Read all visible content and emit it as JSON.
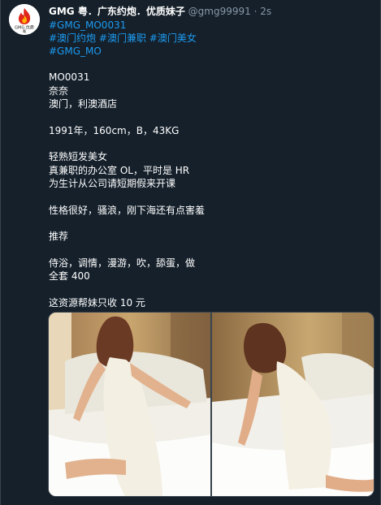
{
  "author": {
    "avatar_text": "GMG.优质",
    "avatar_sub": "粤",
    "display_name": "GMG 粤．广东约炮．优质妹子",
    "handle": "@gmg99991",
    "separator": "·",
    "time": "2s"
  },
  "hashtags": {
    "line1": [
      "#GMG_MO0031"
    ],
    "line2": [
      "#澳门约炮",
      "#澳门兼职",
      "#澳门美女"
    ],
    "line3": [
      "#GMG_MO"
    ]
  },
  "body": {
    "line_id": "MO0031",
    "line_name": "奈奈",
    "line_location": "澳门，利澳酒店",
    "line_stats": "1991年，160cm，B，43KG",
    "line_desc1": "轻熟短发美女",
    "line_desc2": "真兼职的办公室 OL，平时是 HR",
    "line_desc3": "为生计从公司请短期假来开课",
    "line_personality": "性格很好，骚浪，刚下海还有点害羞",
    "line_recommend": "推荐",
    "line_services": "侍浴，调情，漫游，吹，舔蛋，做",
    "line_price": "全套 400",
    "line_fee": "这资源帮妹只收 10 元"
  },
  "media": {
    "photos": [
      "photo-1",
      "photo-2"
    ]
  },
  "colors": {
    "background": "#15202b",
    "link": "#1d9bf0",
    "muted": "#8899a6",
    "border": "#38444d"
  }
}
